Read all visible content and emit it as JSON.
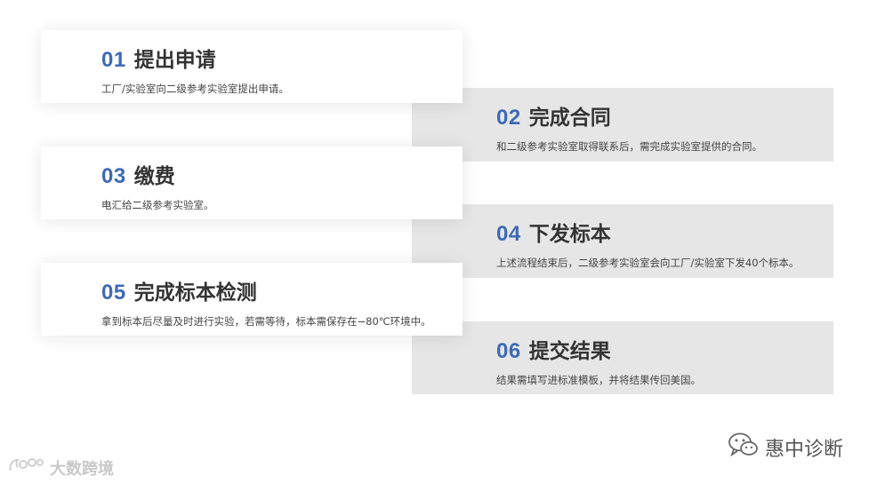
{
  "steps": [
    {
      "num": "01",
      "title": "提出申请",
      "desc": "工厂/实验室向二级参考实验室提出申请。"
    },
    {
      "num": "02",
      "title": "完成合同",
      "desc": "和二级参考实验室取得联系后，需完成实验室提供的合同。"
    },
    {
      "num": "03",
      "title": "缴费",
      "desc": "电汇给二级参考实验室。"
    },
    {
      "num": "04",
      "title": "下发标本",
      "desc": "上述流程结束后，二级参考实验室会向工厂/实验室下发40个标本。"
    },
    {
      "num": "05",
      "title": "完成标本检测",
      "desc": "拿到标本后尽量及时进行实验，若需等待，标本需保存在−80℃环境中。"
    },
    {
      "num": "06",
      "title": "提交结果",
      "desc": "结果需填写进标准模板，并将结果传回美国。"
    }
  ],
  "watermarks": {
    "left": "大数跨境",
    "right": "惠中诊断"
  },
  "colors": {
    "accent": "#3e6ab4",
    "card_gray": "#e6e6e6",
    "title": "#333333"
  },
  "icons": {
    "left_watermark": "weibo-logo-icon",
    "right_watermark": "wechat-logo-icon"
  }
}
